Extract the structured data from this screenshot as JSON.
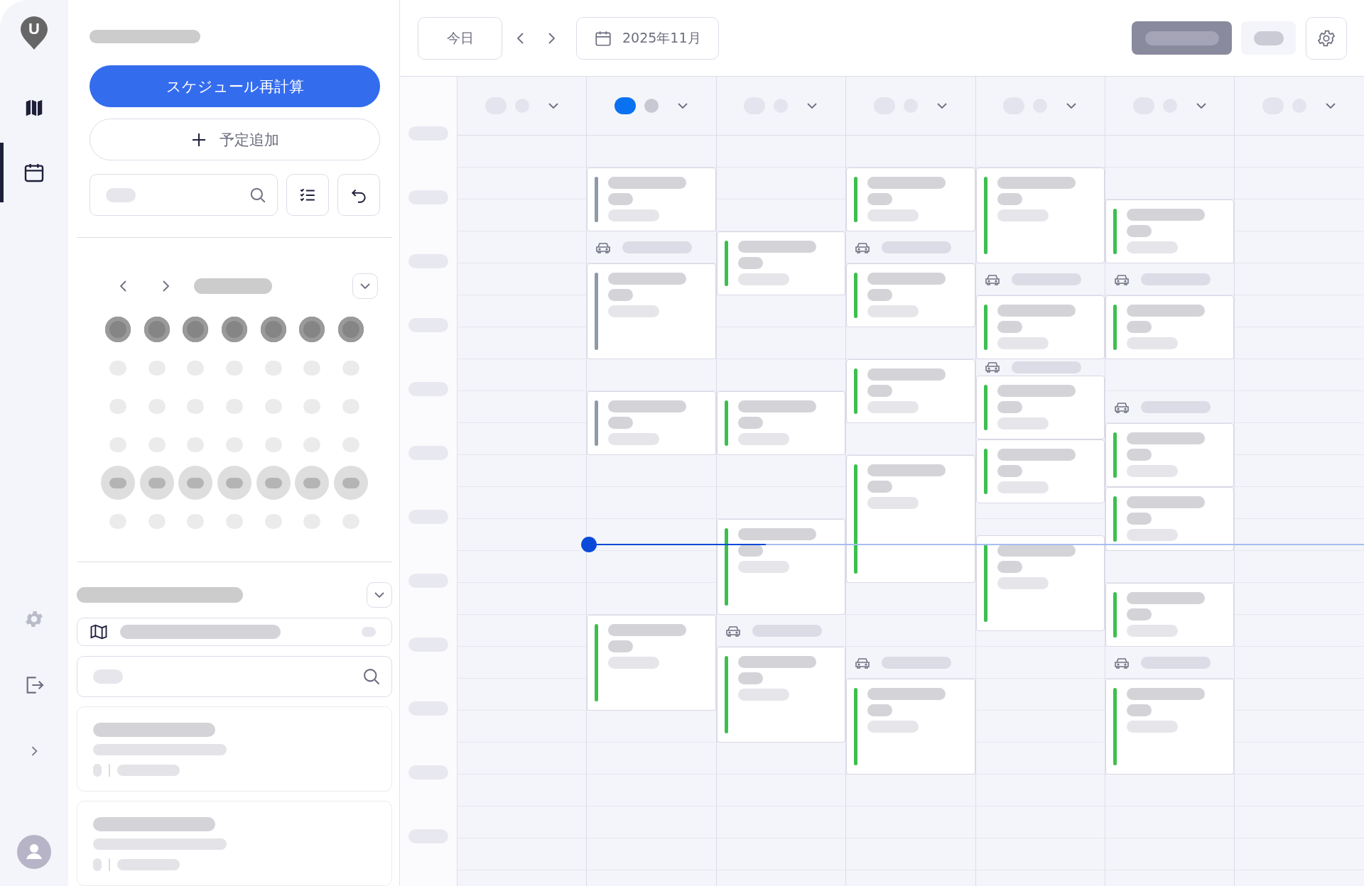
{
  "rail": {
    "logo": {
      "letter": "U"
    },
    "nav": [
      {
        "kind": "map",
        "selected": false
      },
      {
        "kind": "calendar",
        "selected": true
      }
    ],
    "bottom": [
      {
        "kind": "settings"
      },
      {
        "kind": "logout"
      },
      {
        "kind": "expand"
      }
    ]
  },
  "sidebar": {
    "recalc_button": "スケジュール再計算",
    "add_button": "予定追加",
    "mini_calendar": {
      "weeks": [
        {
          "selected": false
        },
        {
          "selected": false
        },
        {
          "selected": false
        },
        {
          "selected": true
        },
        {
          "selected": false
        }
      ]
    },
    "job_cards": [
      {
        "kind": "job"
      },
      {
        "kind": "job"
      }
    ]
  },
  "toolbar": {
    "today_button": "今日",
    "month": "2025年11月"
  },
  "day_columns": [
    {
      "selected": false
    },
    {
      "selected": true,
      "items": [
        {
          "kind": "event",
          "color": "#8e9aa6"
        },
        {
          "kind": "travel"
        },
        {
          "kind": "event",
          "color": "#8e9aa6"
        },
        {
          "kind": "event",
          "color": "#8e9aa6"
        },
        {
          "kind": "event",
          "color": "#3dbf4f"
        }
      ]
    },
    {
      "selected": false,
      "items": [
        {
          "kind": "event",
          "color": "#3dbf4f"
        },
        {
          "kind": "event",
          "color": "#3dbf4f"
        },
        {
          "kind": "event",
          "color": "#3dbf4f"
        },
        {
          "kind": "travel"
        },
        {
          "kind": "event",
          "color": "#3dbf4f"
        }
      ]
    },
    {
      "selected": false,
      "items": [
        {
          "kind": "event",
          "color": "#3dbf4f"
        },
        {
          "kind": "travel"
        },
        {
          "kind": "event",
          "color": "#3dbf4f"
        },
        {
          "kind": "event",
          "color": "#3dbf4f"
        },
        {
          "kind": "event",
          "color": "#3dbf4f"
        },
        {
          "kind": "travel"
        },
        {
          "kind": "event",
          "color": "#3dbf4f"
        }
      ]
    },
    {
      "selected": false,
      "items": [
        {
          "kind": "event",
          "color": "#3dbf4f"
        },
        {
          "kind": "travel"
        },
        {
          "kind": "event",
          "color": "#3dbf4f"
        },
        {
          "kind": "travel"
        },
        {
          "kind": "event",
          "color": "#3dbf4f"
        },
        {
          "kind": "event",
          "color": "#3dbf4f"
        },
        {
          "kind": "event",
          "color": "#3dbf4f"
        }
      ]
    },
    {
      "selected": false,
      "items": [
        {
          "kind": "event",
          "color": "#3dbf4f"
        },
        {
          "kind": "travel"
        },
        {
          "kind": "event",
          "color": "#3dbf4f"
        },
        {
          "kind": "travel"
        },
        {
          "kind": "event",
          "color": "#3dbf4f"
        },
        {
          "kind": "event",
          "color": "#3dbf4f"
        },
        {
          "kind": "event",
          "color": "#3dbf4f"
        },
        {
          "kind": "travel"
        },
        {
          "kind": "event",
          "color": "#3dbf4f"
        }
      ]
    },
    {
      "selected": false
    }
  ]
}
